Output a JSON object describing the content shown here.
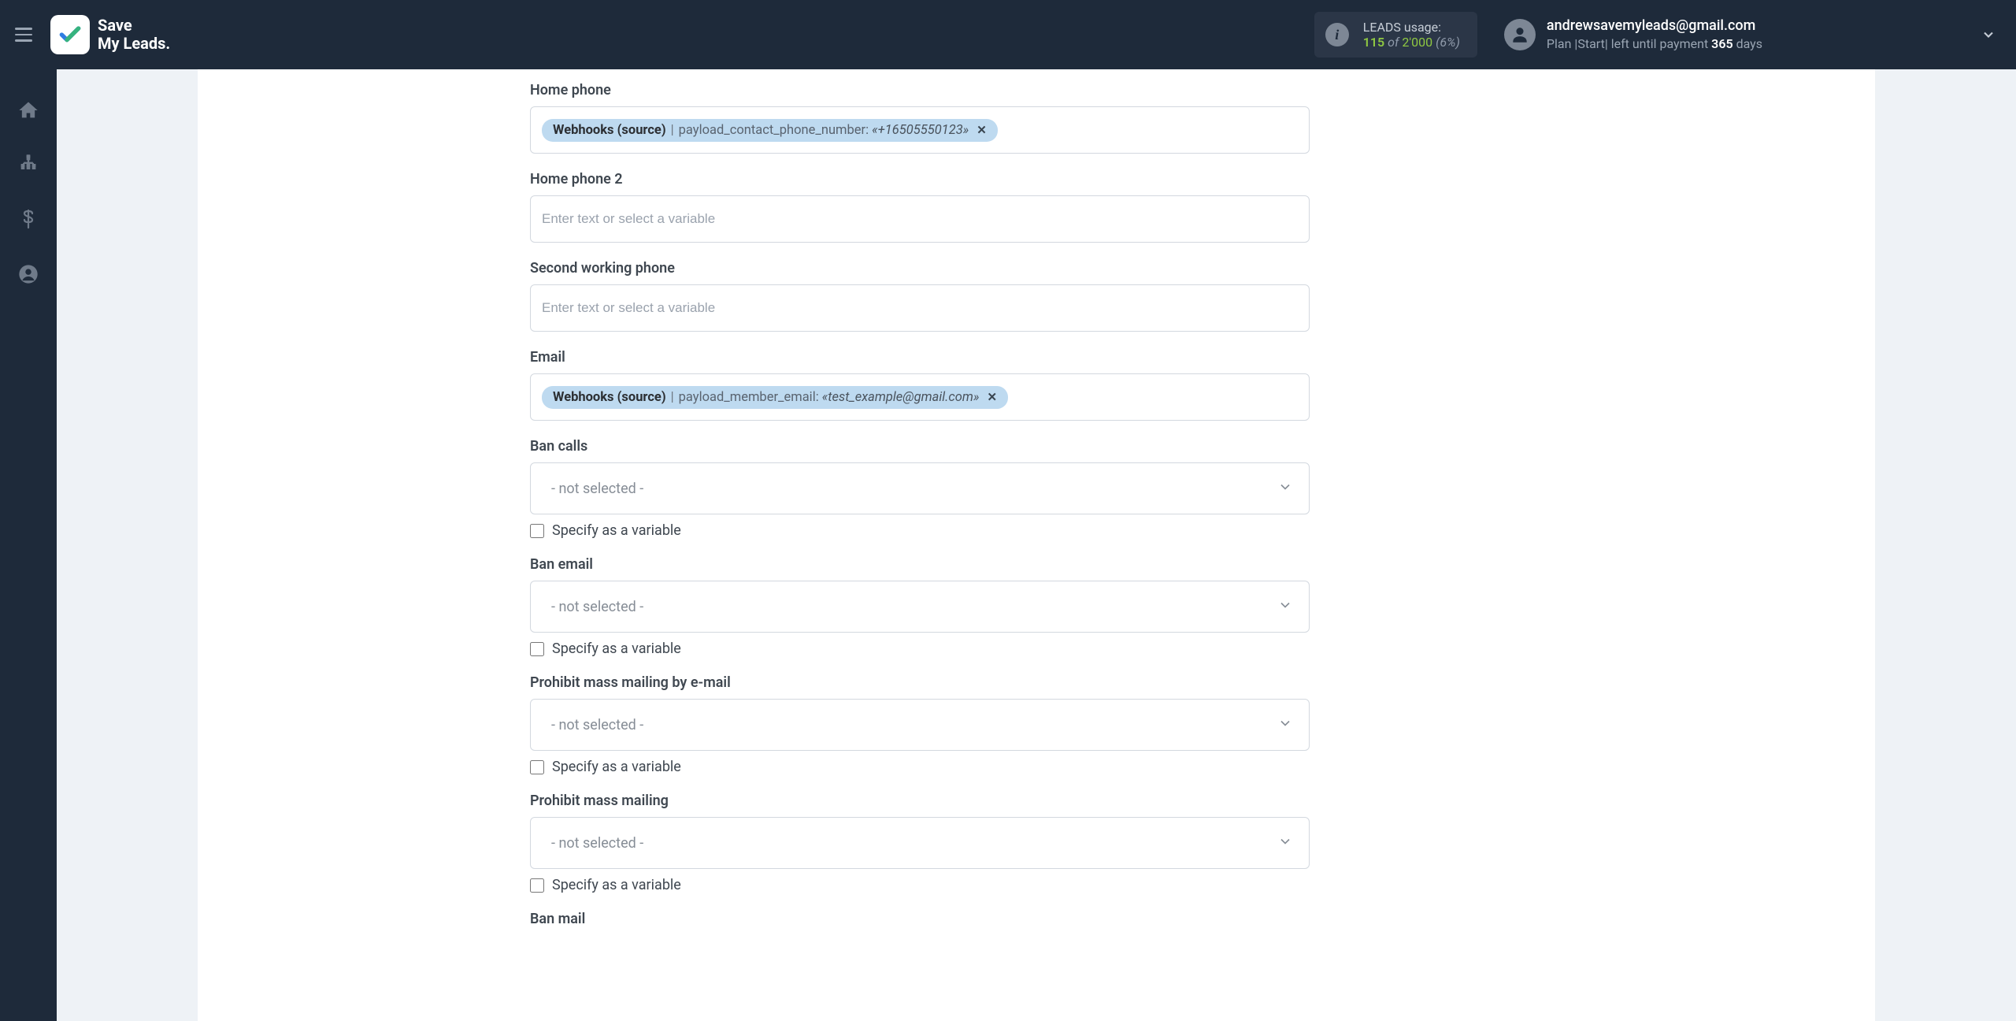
{
  "brand": {
    "line1": "Save",
    "line2": "My Leads."
  },
  "usage": {
    "title": "LEADS usage:",
    "current": "115",
    "of": "of",
    "total": "2'000",
    "percent": "(6%)"
  },
  "user": {
    "email": "andrewsavemyleads@gmail.com",
    "plan_prefix": "Plan",
    "plan_name": "Start",
    "left_text": "left until payment",
    "days": "365",
    "days_label": "days"
  },
  "placeholders": {
    "text_or_var": "Enter text or select a variable"
  },
  "select_default": "- not selected -",
  "checkbox_label": "Specify as a variable",
  "chip_source": "Webhooks (source)",
  "fields": {
    "home_phone": {
      "label": "Home phone",
      "chip_field": "payload_contact_phone_number:",
      "chip_value": "«+16505550123»"
    },
    "home_phone_2": {
      "label": "Home phone 2"
    },
    "second_working_phone": {
      "label": "Second working phone"
    },
    "email": {
      "label": "Email",
      "chip_field": "payload_member_email:",
      "chip_value": "«test_example@gmail.com»"
    },
    "ban_calls": {
      "label": "Ban calls"
    },
    "ban_email": {
      "label": "Ban email"
    },
    "prohibit_mass_mailing_email": {
      "label": "Prohibit mass mailing by e-mail"
    },
    "prohibit_mass_mailing": {
      "label": "Prohibit mass mailing"
    },
    "ban_mail": {
      "label": "Ban mail"
    }
  }
}
